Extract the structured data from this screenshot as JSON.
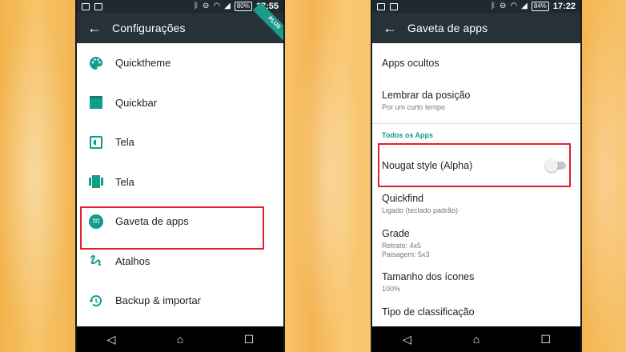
{
  "left": {
    "status": {
      "battery": "80%",
      "time": "17:55"
    },
    "title": "Configurações",
    "badge": "PLUS",
    "items": [
      {
        "label": "Quickthemе",
        "icon": "palette-icon"
      },
      {
        "label": "Quickbar",
        "icon": "quickbar-icon"
      },
      {
        "label": "Tela",
        "icon": "brightness-icon"
      },
      {
        "label": "Tela",
        "icon": "view-carousel-icon"
      },
      {
        "label": "Gaveta de apps",
        "icon": "apps-dots-icon"
      },
      {
        "label": "Atalhos",
        "icon": "gesture-icon"
      },
      {
        "label": "Backup & importar",
        "icon": "restore-icon"
      }
    ]
  },
  "right": {
    "status": {
      "battery": "84%",
      "time": "17:22"
    },
    "title": "Gaveta de apps",
    "items": [
      {
        "title": "Apps ocultos"
      },
      {
        "title": "Lembrar da posição",
        "sub": "Por um curto tempo"
      },
      {
        "section": "Todos os Apps"
      },
      {
        "title": "Nougat style (Alpha)",
        "toggle_on": false
      },
      {
        "title": "Quickfind",
        "sub": "Ligado (teclado padrão)"
      },
      {
        "title": "Grade",
        "sub": "Retrato: 4x5",
        "sub2": "Paisagem: 5x3"
      },
      {
        "title": "Tamanho dos ícones",
        "sub": "100%"
      },
      {
        "title": "Tipo de classificação"
      }
    ]
  },
  "colors": {
    "accent": "#139b8b",
    "appbar": "#263238",
    "highlight": "#e0202a"
  }
}
